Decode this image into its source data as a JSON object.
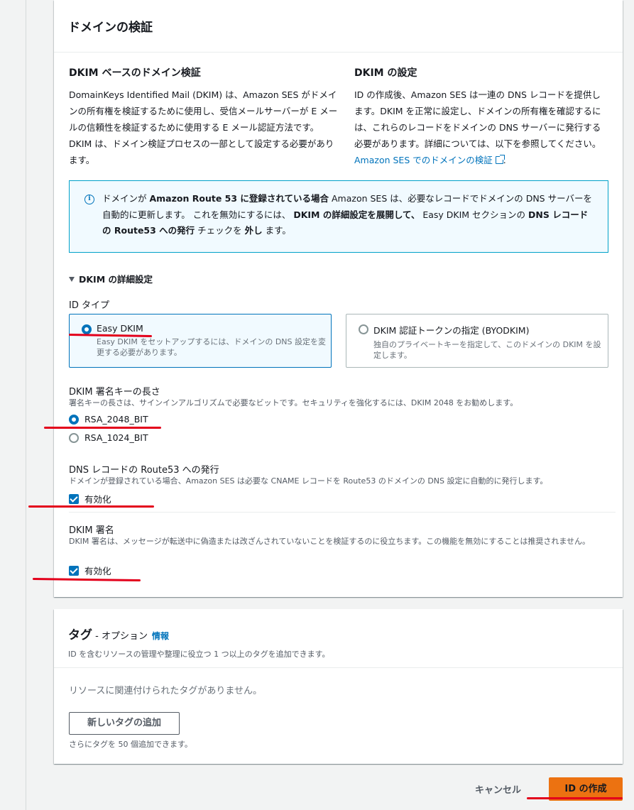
{
  "domain_panel": {
    "title": "ドメインの検証",
    "left_heading": "DKIM ベースのドメイン検証",
    "left_body": "DomainKeys Identified Mail (DKIM) は、Amazon SES がドメインの所有権を検証するために使用し、受信メールサーバーが E メールの信頼性を検証するために使用する E メール認証方法です。DKIM は、ドメイン検証プロセスの一部として設定する必要があります。",
    "right_heading": "DKIM の設定",
    "right_body": "ID の作成後、Amazon SES は一連の DNS レコードを提供します。DKIM を正常に設定し、ドメインの所有権を確認するには、これらのレコードをドメインの DNS サーバーに発行する必要があります。詳細については、以下を参照してください。",
    "right_link": "Amazon SES でのドメインの検証"
  },
  "info_box": {
    "t1": "ドメインが ",
    "b1": "Amazon Route 53 に登録されている場合",
    "t2": " Amazon SES は、必要なレコードでドメインの DNS サーバーを自動的に更新します。 これを無効にするには、 ",
    "b2": "DKIM の詳細設定を展開して、",
    "t3": " Easy DKIM セクションの ",
    "b3": "DNS レコードの Route53 への発行",
    "t4": " チェックを ",
    "b4": "外し",
    "t5": " ます。"
  },
  "advanced": {
    "label": "DKIM の詳細設定",
    "identity_type_label": "ID タイプ",
    "easy_dkim": {
      "title": "Easy DKIM",
      "desc": "Easy DKIM をセットアップするには、ドメインの DNS 設定を変更する必要があります。"
    },
    "byodkim": {
      "title": "DKIM 認証トークンの指定 (BYODKIM)",
      "desc": "独自のプライベートキーを指定して、このドメインの DKIM を設定します。"
    },
    "key_length_label": "DKIM 署名キーの長さ",
    "key_length_desc": "署名キーの長さは、サインインアルゴリズムで必要なビットです。セキュリティを強化するには、DKIM 2048 をお勧めします。",
    "rsa2048": "RSA_2048_BIT",
    "rsa1024": "RSA_1024_BIT",
    "route53_label": "DNS レコードの Route53 への発行",
    "route53_desc": "ドメインが登録されている場合、Amazon SES は必要な CNAME レコードを Route53 のドメインの DNS 設定に自動的に発行します。",
    "route53_check": "有効化",
    "signing_label": "DKIM 署名",
    "signing_desc": "DKIM 署名は、メッセージが転送中に偽造または改ざんされていないことを検証するのに役立ちます。この機能を無効にすることは推奨されません。",
    "signing_check": "有効化"
  },
  "tags_panel": {
    "title": "タグ",
    "optional": " - オプション",
    "info": "情報",
    "desc": "ID を含むリソースの管理や整理に役立つ 1 つ以上のタグを追加できます。",
    "empty": "リソースに関連付けられたタグがありません。",
    "add_button": "新しいタグの追加",
    "limit": "さらにタグを 50 個追加できます。"
  },
  "footer": {
    "cancel": "キャンセル",
    "create": "ID の作成"
  },
  "colors": {
    "accent": "#0073bb",
    "primary_button": "#ec7211",
    "annotation": "#e3001b"
  }
}
